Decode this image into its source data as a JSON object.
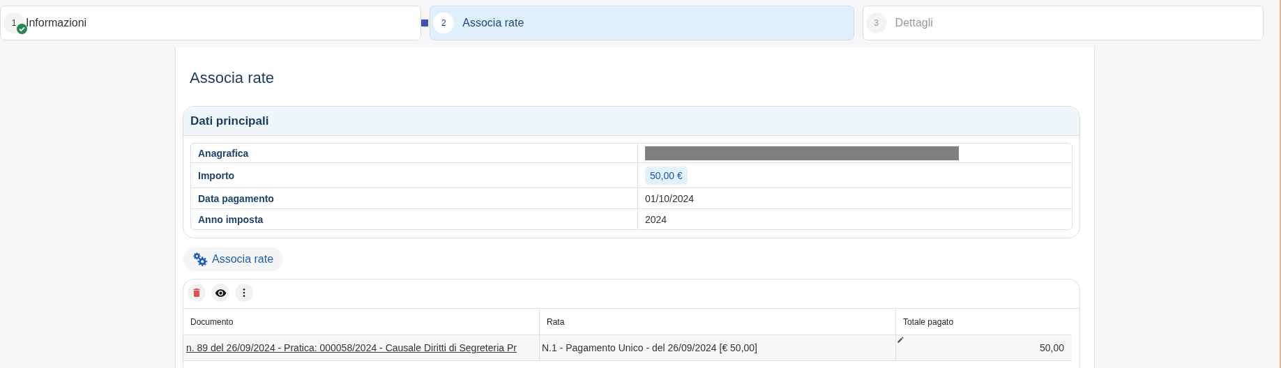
{
  "steps": [
    {
      "number": "1",
      "label": "Informazioni",
      "selected": false,
      "completed": true
    },
    {
      "number": "2",
      "label": "Associa rate",
      "selected": true,
      "completed": false
    },
    {
      "number": "3",
      "label": "Dettagli",
      "selected": false,
      "completed": false
    }
  ],
  "page_title": "Associa rate",
  "main_data": {
    "title": "Dati principali",
    "rows": [
      {
        "label": "Anagrafica",
        "kind": "redacted"
      },
      {
        "label": "Importo",
        "kind": "chip",
        "value": "50,00 €"
      },
      {
        "label": "Data pagamento",
        "kind": "text",
        "value": "01/10/2024"
      },
      {
        "label": "Anno imposta",
        "kind": "text",
        "value": "2024"
      }
    ]
  },
  "associate_button": "Associa rate",
  "table": {
    "columns": [
      "Documento",
      "Rata",
      "Totale pagato"
    ],
    "rows": [
      {
        "documento": "n. 89 del 26/09/2024 - Pratica: 000058/2024 - Causale Diritti di Segreteria Pr",
        "rata": "N.1 - Pagamento Unico - del 26/09/2024 [€ 50,00]",
        "totale": "50,00",
        "editable": true
      }
    ]
  }
}
